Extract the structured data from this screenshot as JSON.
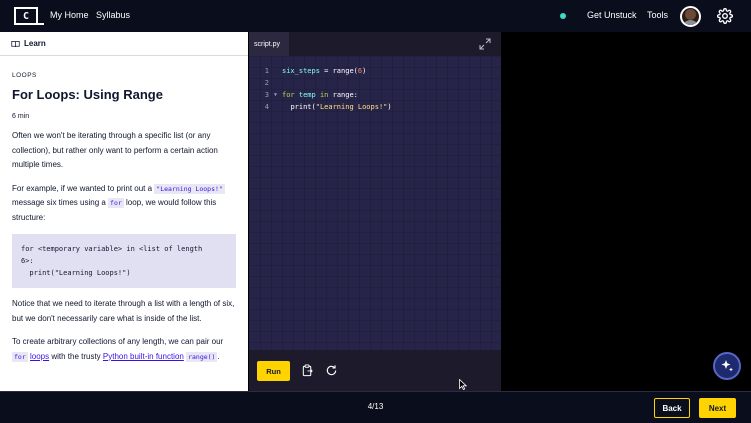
{
  "topnav": {
    "logo_text": "C",
    "links": [
      "My Home",
      "Syllabus"
    ],
    "right_links": [
      "Get Unstuck",
      "Tools"
    ],
    "status_color": "#3adcc6"
  },
  "learn": {
    "header_label": "Learn",
    "kicker": "LOOPS",
    "title": "For Loops: Using Range",
    "duration": "6 min",
    "p1": "Often we won't be iterating through a specific list (or any collection), but rather only want to perform a certain action multiple times.",
    "p2_a": "For example, if we wanted to print out a ",
    "p2_code1": "\"Learning Loops!\"",
    "p2_b": " message six times using a ",
    "p2_code2": "for",
    "p2_c": " loop, we would follow this structure:",
    "code_block": "for <temporary variable> in <list of length\n6>:\n  print(\"Learning Loops!\")",
    "p3": "Notice that we need to iterate through a list with a length of six, but we don't necessarily care what is inside of the list.",
    "p4_a": "To create arbitrary collections of any length, we can pair our ",
    "p4_code1": "for",
    "p4_b": " ",
    "p4_link1": "loops",
    "p4_c": " with the trusty ",
    "p4_link2": "Python built-in function",
    "p4_d": " ",
    "p4_code2": "range()",
    "p4_e": "."
  },
  "editor": {
    "tab_label": "script.py",
    "lines": [
      {
        "n": "1",
        "fold": ""
      },
      {
        "n": "2",
        "fold": ""
      },
      {
        "n": "3",
        "fold": "▼"
      },
      {
        "n": "4",
        "fold": ""
      }
    ],
    "l1": {
      "var": "six_steps",
      "op": " = ",
      "fn": "range(",
      "num": "6",
      "end": ")"
    },
    "l3": {
      "kw1": "for",
      "var": " temp ",
      "kw2": "in",
      "rest": " range:"
    },
    "l4": {
      "indent": "  ",
      "fn": "print(",
      "str": "\"Learning Loops!\"",
      "end": ")"
    },
    "run_label": "Run"
  },
  "footer": {
    "progress": "4/13",
    "back_label": "Back",
    "next_label": "Next",
    "accent": "#ffd300"
  }
}
